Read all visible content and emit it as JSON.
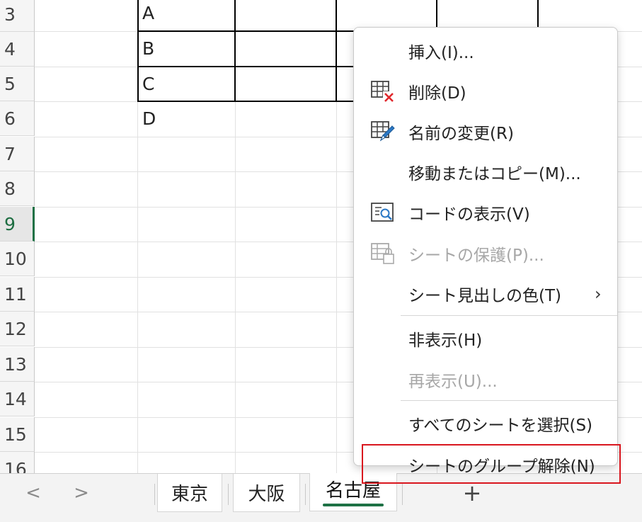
{
  "rows": [
    "3",
    "4",
    "5",
    "6",
    "7",
    "8",
    "9",
    "10",
    "11",
    "12",
    "13",
    "14",
    "15",
    "16"
  ],
  "active_row": "9",
  "cells": [
    "A",
    "B",
    "C",
    "D"
  ],
  "context_menu": {
    "items": [
      {
        "label": "挿入(I)...",
        "icon": "",
        "enabled": true
      },
      {
        "label": "削除(D)",
        "icon": "delete-sheet-icon",
        "enabled": true
      },
      {
        "label": "名前の変更(R)",
        "icon": "rename-sheet-icon",
        "enabled": true
      },
      {
        "label": "移動またはコピー(M)...",
        "icon": "",
        "enabled": true
      },
      {
        "label": "コードの表示(V)",
        "icon": "view-code-icon",
        "enabled": true
      },
      {
        "label": "シートの保護(P)...",
        "icon": "protect-sheet-icon",
        "enabled": false
      },
      {
        "label": "シート見出しの色(T)",
        "icon": "",
        "enabled": true,
        "submenu": true
      },
      {
        "label": "非表示(H)",
        "icon": "",
        "enabled": true
      },
      {
        "label": "再表示(U)...",
        "icon": "",
        "enabled": false
      },
      {
        "label": "すべてのシートを選択(S)",
        "icon": "",
        "enabled": true
      },
      {
        "label": "シートのグループ解除(N)",
        "icon": "",
        "enabled": true,
        "highlighted": true
      }
    ]
  },
  "sheet_tabs": [
    {
      "label": "東京",
      "active": false
    },
    {
      "label": "大阪",
      "active": false
    },
    {
      "label": "名古屋",
      "active": true
    }
  ],
  "tabbar": {
    "prev": "<",
    "next": ">",
    "add": "+"
  },
  "colors": {
    "accent": "#1e7145",
    "highlight": "#d9161e",
    "delete_x": "#e0262b",
    "pencil": "#2b78c5"
  }
}
